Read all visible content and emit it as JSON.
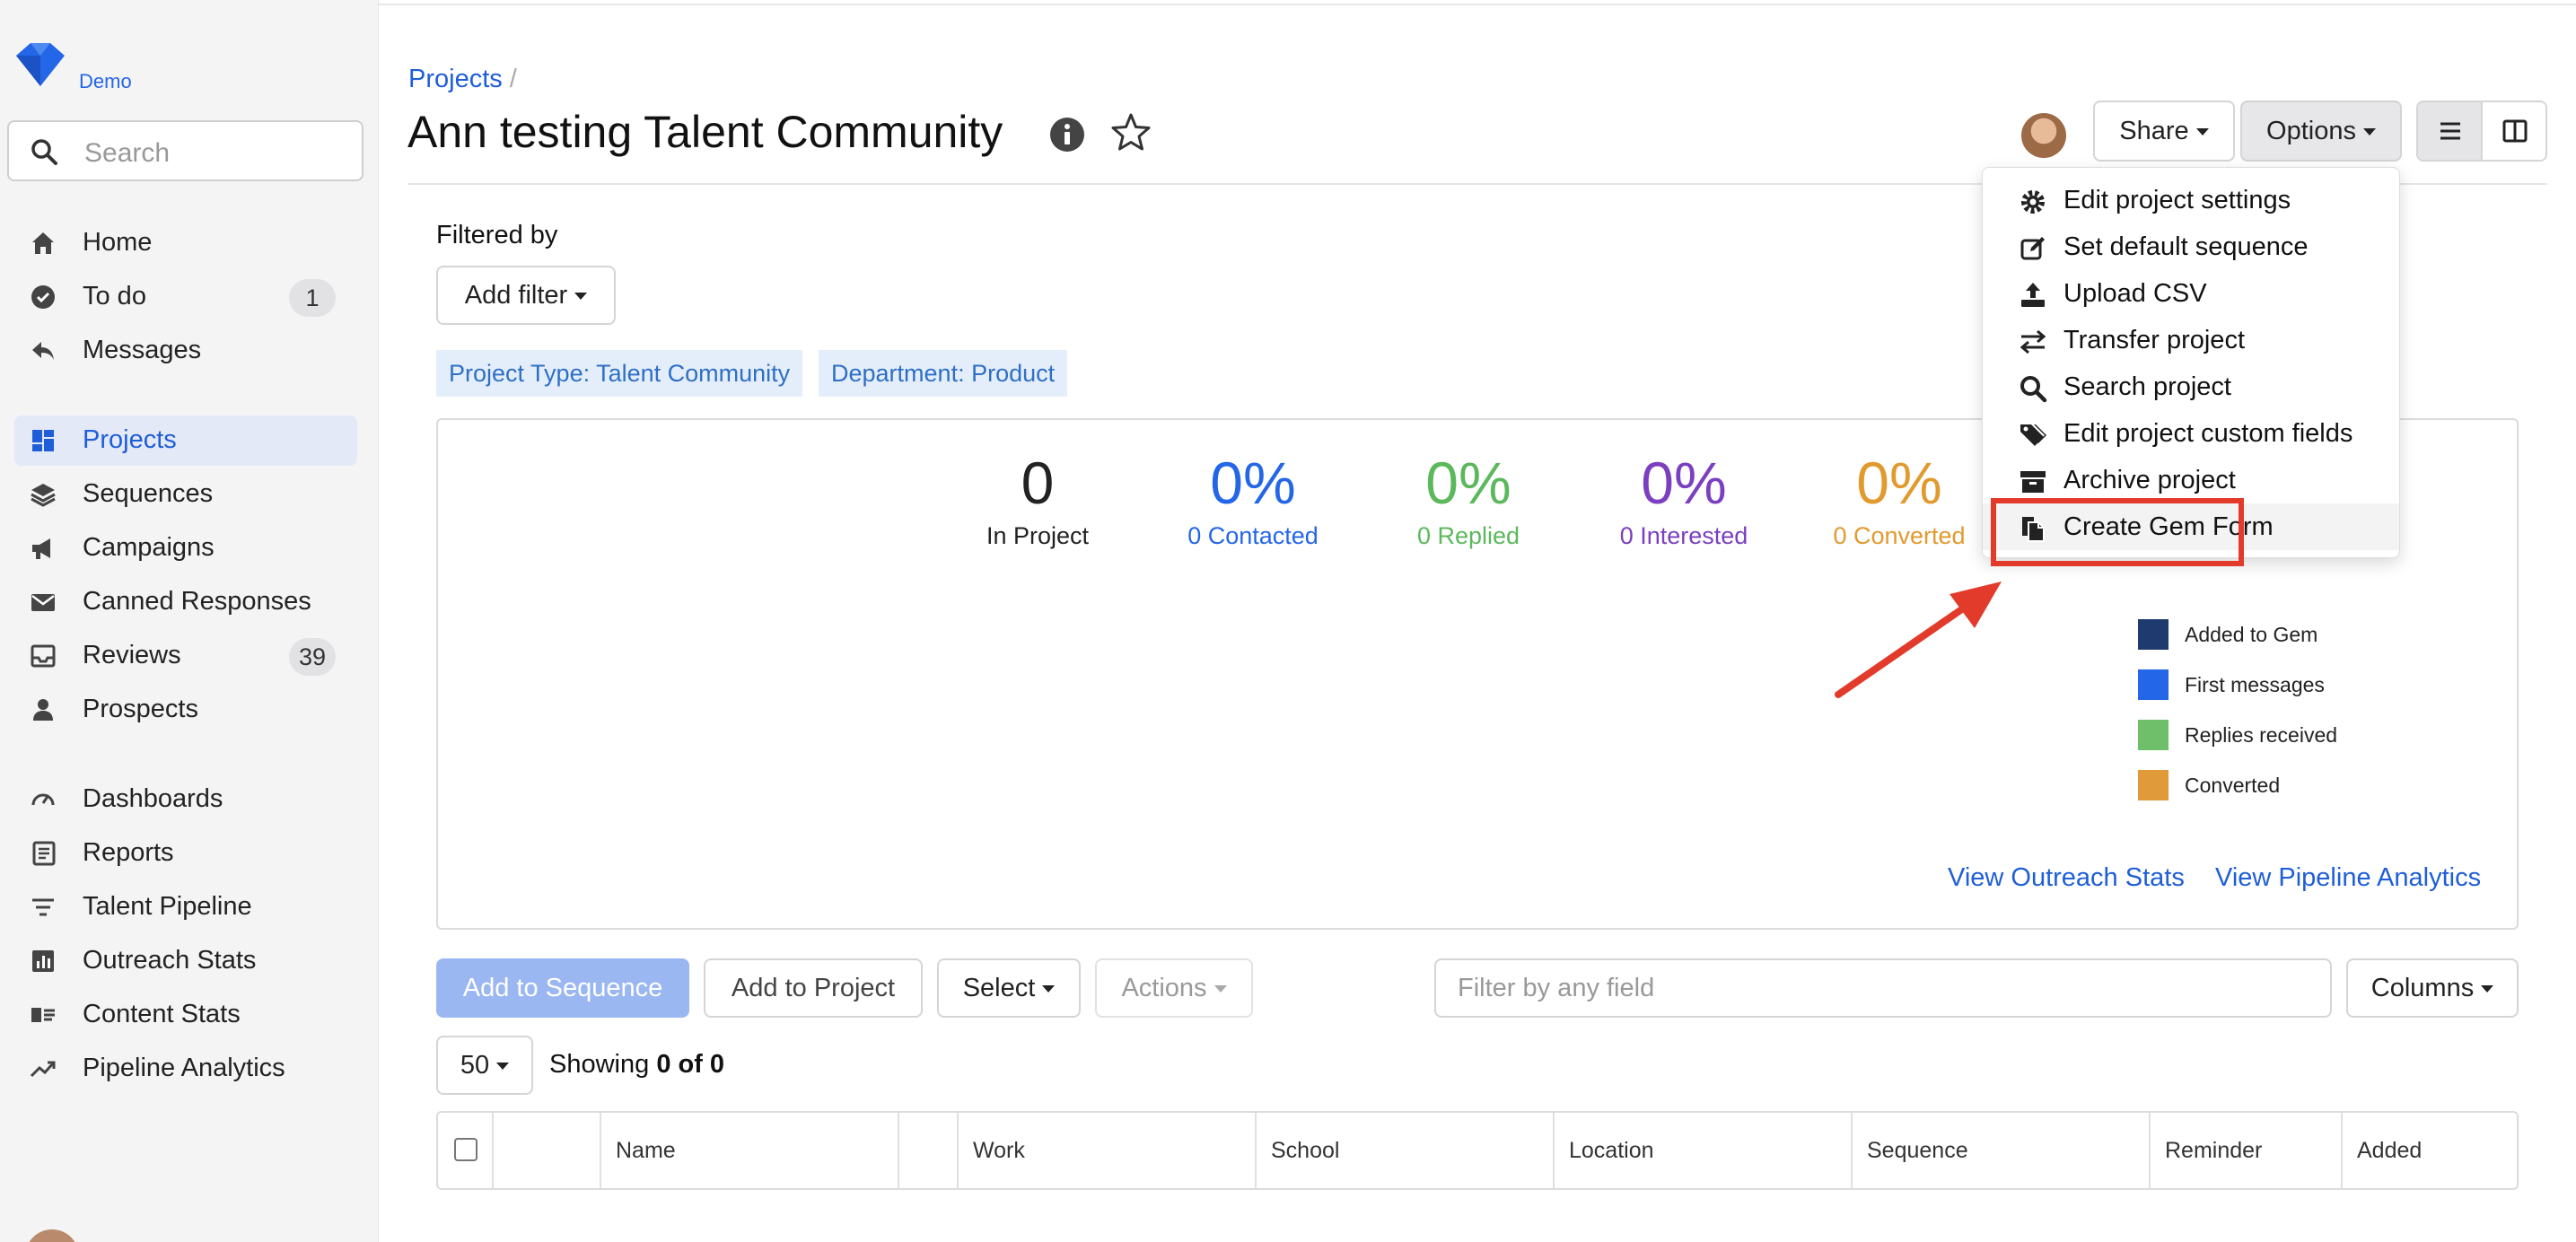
{
  "app": {
    "logo_label": "Demo",
    "accent": "#1f5ed8",
    "logo_icon": "gem-diamond-icon"
  },
  "sidebar": {
    "search_placeholder": "Search",
    "items": [
      {
        "label": "Home",
        "icon": "home-icon"
      },
      {
        "label": "To do",
        "icon": "check-circle-icon",
        "badge": "1"
      },
      {
        "label": "Messages",
        "icon": "reply-icon"
      },
      {
        "label": "Projects",
        "icon": "grid-icon",
        "active": true
      },
      {
        "label": "Sequences",
        "icon": "layers-icon"
      },
      {
        "label": "Campaigns",
        "icon": "megaphone-icon"
      },
      {
        "label": "Canned Responses",
        "icon": "mail-icon"
      },
      {
        "label": "Reviews",
        "icon": "inbox-icon",
        "badge": "39"
      },
      {
        "label": "Prospects",
        "icon": "person-icon"
      },
      {
        "label": "Dashboards",
        "icon": "gauge-icon"
      },
      {
        "label": "Reports",
        "icon": "report-icon"
      },
      {
        "label": "Talent Pipeline",
        "icon": "funnel-icon"
      },
      {
        "label": "Outreach Stats",
        "icon": "bar-chart-icon"
      },
      {
        "label": "Content Stats",
        "icon": "content-card-icon"
      },
      {
        "label": "Pipeline Analytics",
        "icon": "trend-up-icon"
      }
    ]
  },
  "header": {
    "breadcrumb": "Projects",
    "breadcrumb_sep": "/",
    "title": "Ann testing Talent Community",
    "share_label": "Share",
    "options_label": "Options"
  },
  "filters": {
    "label": "Filtered by",
    "add_filter_label": "Add filter",
    "tags": [
      "Project Type: Talent Community",
      "Department: Product"
    ]
  },
  "stats": {
    "items": [
      {
        "value": "0",
        "label": "In Project",
        "color": "#222222"
      },
      {
        "value": "0%",
        "label": "0 Contacted",
        "color": "#2466e8"
      },
      {
        "value": "0%",
        "label": "0 Replied",
        "color": "#5cb85c"
      },
      {
        "value": "0%",
        "label": "0 Interested",
        "color": "#7b3fbf"
      },
      {
        "value": "0%",
        "label": "0 Converted",
        "color": "#e19a2e"
      }
    ],
    "legend": [
      {
        "label": "Added to Gem",
        "color": "#1f3a6e"
      },
      {
        "label": "First messages",
        "color": "#2466e8"
      },
      {
        "label": "Replies received",
        "color": "#6fbf6a"
      },
      {
        "label": "Converted",
        "color": "#e19a3a"
      }
    ],
    "link_outreach": "View Outreach Stats",
    "link_pipeline": "View Pipeline Analytics"
  },
  "toolbar": {
    "add_to_sequence": "Add to Sequence",
    "add_to_project": "Add to Project",
    "select": "Select",
    "actions": "Actions",
    "filter_placeholder": "Filter by any field",
    "columns": "Columns",
    "page_size": "50",
    "showing_prefix": "Showing ",
    "showing_bold": "0 of 0"
  },
  "table": {
    "columns": [
      "Name",
      "Work",
      "School",
      "Location",
      "Sequence",
      "Reminder",
      "Added"
    ]
  },
  "dropdown": {
    "items": [
      {
        "label": "Edit project settings",
        "icon": "gear-icon"
      },
      {
        "label": "Set default sequence",
        "icon": "edit-square-icon"
      },
      {
        "label": "Upload CSV",
        "icon": "upload-icon"
      },
      {
        "label": "Transfer project",
        "icon": "transfer-arrows-icon"
      },
      {
        "label": "Search project",
        "icon": "search-icon"
      },
      {
        "label": "Edit project custom fields",
        "icon": "tags-icon"
      },
      {
        "label": "Archive project",
        "icon": "archive-icon"
      },
      {
        "label": "Create Gem Form",
        "icon": "copy-doc-icon",
        "highlighted": true
      }
    ],
    "annotation_color": "#e23b2c"
  }
}
